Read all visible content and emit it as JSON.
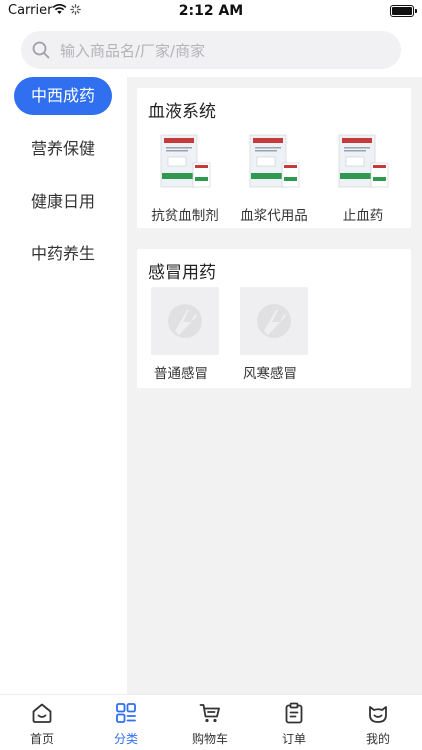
{
  "status_bar": {
    "carrier": "Carrier",
    "time": "2:12 AM"
  },
  "search": {
    "placeholder": "输入商品名/厂家/商家"
  },
  "side_nav": {
    "items": [
      {
        "label": "中西成药",
        "active": true
      },
      {
        "label": "营养保健",
        "active": false
      },
      {
        "label": "健康日用",
        "active": false
      },
      {
        "label": "中药养生",
        "active": false
      }
    ]
  },
  "sections": [
    {
      "title": "血液系统",
      "products": [
        {
          "label": "抗贫血制剂"
        },
        {
          "label": "血浆代用品"
        },
        {
          "label": "止血药"
        }
      ]
    },
    {
      "title": "感冒用药",
      "products": [
        {
          "label": "普通感冒"
        },
        {
          "label": "风寒感冒"
        }
      ]
    }
  ],
  "tab_bar": {
    "tabs": [
      {
        "label": "首页",
        "icon": "home-icon"
      },
      {
        "label": "分类",
        "icon": "category-grid-icon",
        "active": true
      },
      {
        "label": "购物车",
        "icon": "cart-icon"
      },
      {
        "label": "订单",
        "icon": "clipboard-icon"
      },
      {
        "label": "我的",
        "icon": "profile-face-icon"
      }
    ]
  },
  "colors": {
    "accent": "#2f6ff0",
    "content_bg": "#f2f2f2",
    "search_bg": "#f1f1f3"
  }
}
